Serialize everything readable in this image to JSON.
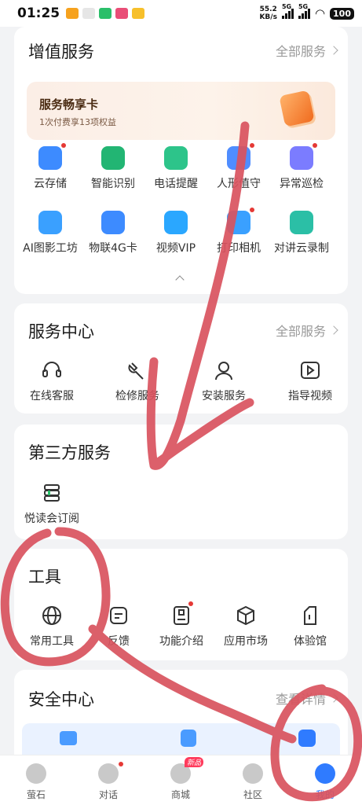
{
  "status_bar": {
    "time": "01:25",
    "speed_value": "55.2",
    "speed_unit": "KB/s",
    "sig1": "5G",
    "sig2": "5G",
    "battery": "100"
  },
  "value_services": {
    "title": "增值服务",
    "more": "全部服务",
    "promo": {
      "title": "服务畅享卡",
      "subtitle": "1次付费享13项权益"
    },
    "items": [
      {
        "label": "云存储",
        "icon": "cloud-storage-icon",
        "color": "#3d8bff"
      },
      {
        "label": "智能识别",
        "icon": "ai-recognition-icon",
        "color": "#22b573"
      },
      {
        "label": "电话提醒",
        "icon": "phone-alert-icon",
        "color": "#2dc48a"
      },
      {
        "label": "人形值守",
        "icon": "human-guard-icon",
        "color": "#4f8dff"
      },
      {
        "label": "异常巡检",
        "icon": "anomaly-inspect-icon",
        "color": "#7b7cff"
      },
      {
        "label": "AI图影工坊",
        "icon": "ai-image-icon",
        "color": "#3aa0ff"
      },
      {
        "label": "物联4G卡",
        "icon": "iot-4g-card-icon",
        "color": "#3d8bff"
      },
      {
        "label": "视频VIP",
        "icon": "video-vip-icon",
        "color": "#2aa7ff"
      },
      {
        "label": "打印相机",
        "icon": "print-camera-icon",
        "color": "#3aa0ff"
      },
      {
        "label": "对讲云录制",
        "icon": "intercom-record-icon",
        "color": "#2bbfa6"
      }
    ]
  },
  "service_center": {
    "title": "服务中心",
    "more": "全部服务",
    "items": [
      {
        "label": "在线客服",
        "icon": "headset-icon"
      },
      {
        "label": "检修服务",
        "icon": "wrench-icon"
      },
      {
        "label": "安装服务",
        "icon": "installer-icon"
      },
      {
        "label": "指导视频",
        "icon": "play-video-icon"
      }
    ]
  },
  "third_party": {
    "title": "第三方服务",
    "items": [
      {
        "label": "悦读会订阅",
        "icon": "books-icon"
      }
    ]
  },
  "tools": {
    "title": "工具",
    "items": [
      {
        "label": "常用工具",
        "icon": "globe-icon"
      },
      {
        "label": "反馈",
        "icon": "feedback-icon"
      },
      {
        "label": "功能介绍",
        "icon": "book-icon"
      },
      {
        "label": "应用市场",
        "icon": "cube-icon"
      },
      {
        "label": "体验馆",
        "icon": "building-icon"
      }
    ]
  },
  "security_center": {
    "title": "安全中心",
    "more": "查看详情"
  },
  "tab_bar": {
    "items": [
      {
        "label": "萤石",
        "icon": "ezviz-icon"
      },
      {
        "label": "对话",
        "icon": "chat-icon"
      },
      {
        "label": "商城",
        "icon": "mall-icon",
        "badge": "新品"
      },
      {
        "label": "社区",
        "icon": "community-icon"
      },
      {
        "label": "我的",
        "icon": "profile-icon"
      }
    ]
  },
  "colors": {
    "accent": "#2f7bff",
    "annotation": "#d9535e",
    "red_dot": "#e53935"
  }
}
